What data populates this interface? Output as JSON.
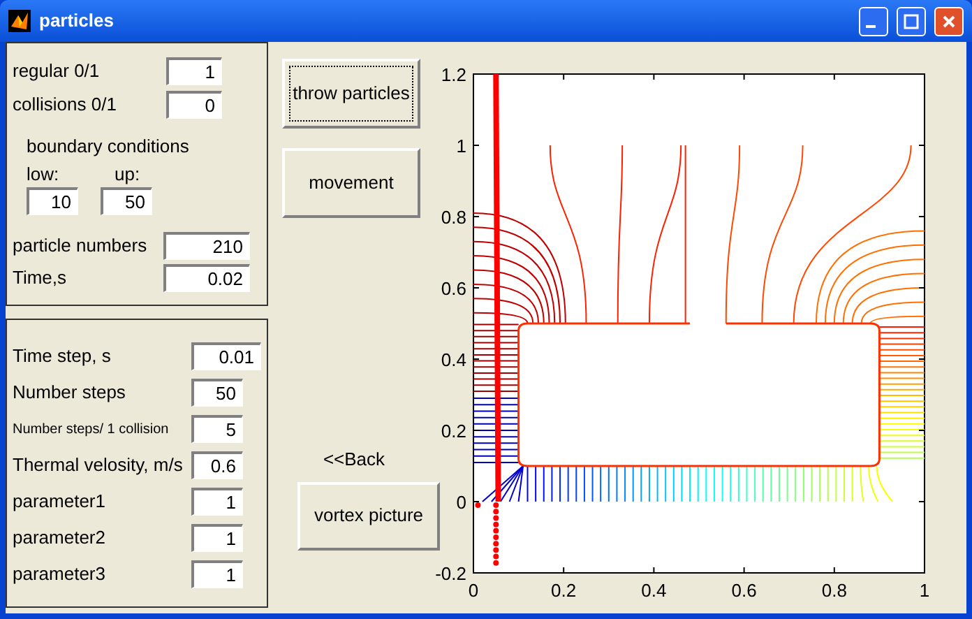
{
  "window": {
    "title": "particles"
  },
  "panel_1": {
    "fields_top": [
      {
        "label": "regular 0/1",
        "value": "1"
      },
      {
        "label": "collisions 0/1",
        "value": "0"
      }
    ],
    "boundary": {
      "title": "boundary conditions",
      "low": {
        "label": "low:",
        "value": "10"
      },
      "up": {
        "label": "up:",
        "value": "50"
      }
    },
    "fields_bottom": [
      {
        "label": "particle numbers",
        "value": "210"
      },
      {
        "label": "Time,s",
        "value": "0.02"
      }
    ]
  },
  "panel_2": {
    "fields": [
      {
        "label": "Time step, s",
        "value": "0.01",
        "kind": "normal"
      },
      {
        "label": "Number steps",
        "value": "50",
        "kind": "normal"
      },
      {
        "label": "Number steps/ 1 collision",
        "value": "5",
        "kind": "small"
      },
      {
        "label": "Thermal velosity, m/s",
        "value": "0.6",
        "kind": "normal"
      },
      {
        "label": "parameter1",
        "value": "1",
        "kind": "normal"
      },
      {
        "label": "parameter2",
        "value": "1",
        "kind": "normal"
      },
      {
        "label": "parameter3",
        "value": "1",
        "kind": "normal"
      }
    ]
  },
  "buttons": [
    {
      "label": "throw particles",
      "focused": true
    },
    {
      "label": "movement",
      "focused": false
    }
  ],
  "back_label": "<<Back",
  "vortex_button": {
    "label": "vortex picture",
    "focused": false
  },
  "plot": {
    "xticks": [
      "0",
      "0.2",
      "0.4",
      "0.6",
      "0.8",
      "1"
    ],
    "yticks": [
      "1.2",
      "1",
      "0.8",
      "0.6",
      "0.4",
      "0.2",
      "0",
      "-0.2"
    ]
  }
}
